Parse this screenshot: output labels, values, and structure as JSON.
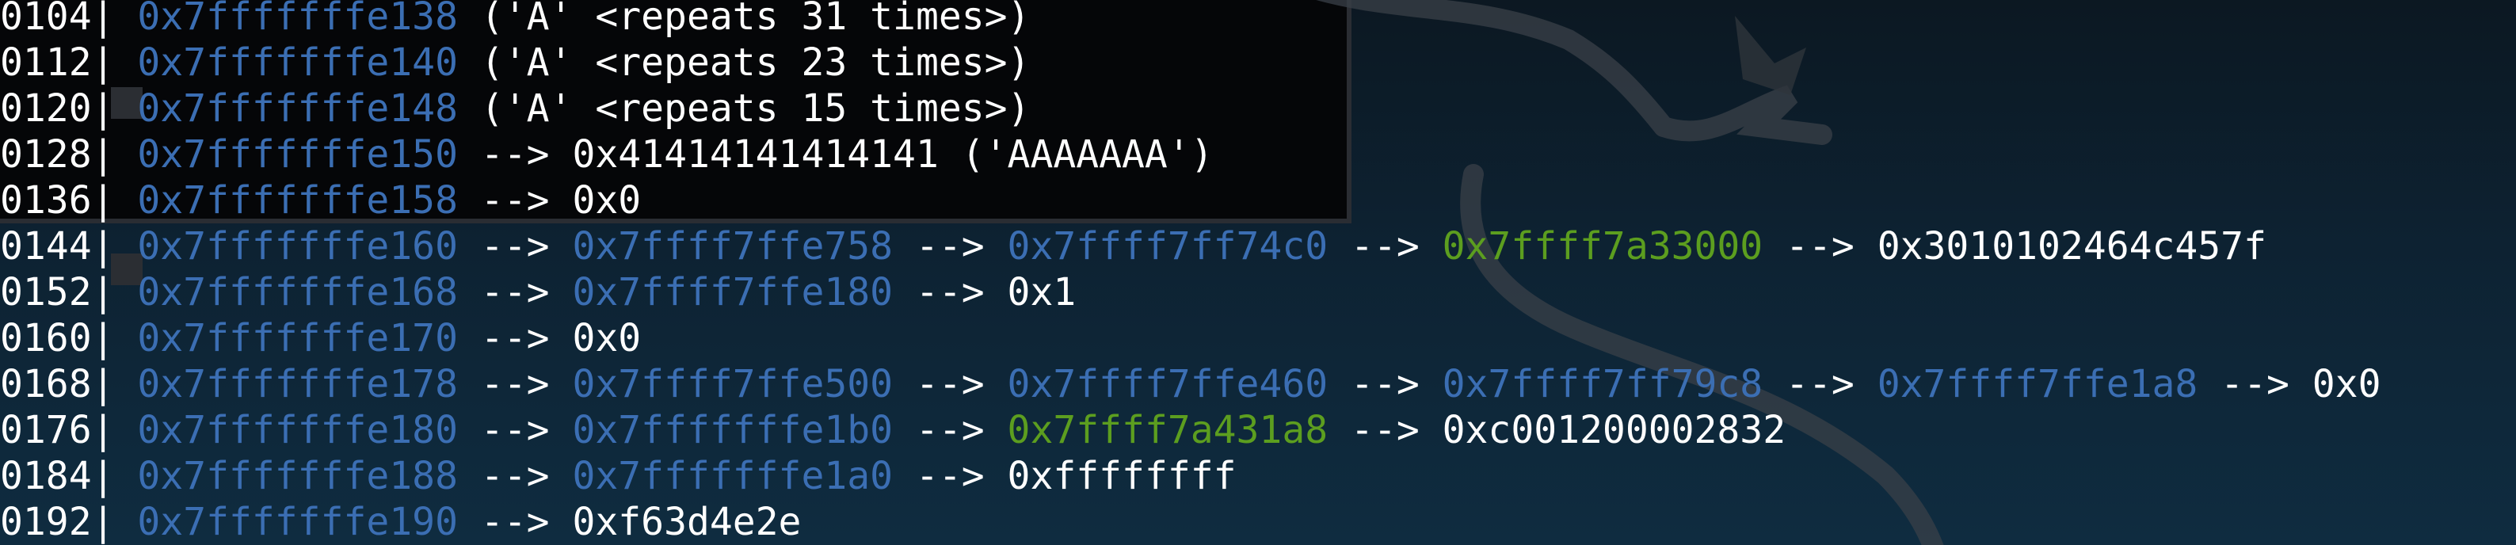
{
  "colors": {
    "stack_address": "#3b6eb3",
    "code_address": "#5c9e1f",
    "value": "#ffffff",
    "background": "#0d2232"
  },
  "lines": [
    {
      "segments": [
        {
          "t": "0104| ",
          "c": "offset"
        },
        {
          "t": "0x7fffffffe138",
          "c": "addr"
        },
        {
          "t": " ('A' <repeats 31 times>)",
          "c": "text"
        }
      ]
    },
    {
      "segments": [
        {
          "t": "0112| ",
          "c": "offset"
        },
        {
          "t": "0x7fffffffe140",
          "c": "addr"
        },
        {
          "t": " ('A' <repeats 23 times>)",
          "c": "text"
        }
      ]
    },
    {
      "segments": [
        {
          "t": "0120| ",
          "c": "offset"
        },
        {
          "t": "0x7fffffffe148",
          "c": "addr"
        },
        {
          "t": " ('A' <repeats 15 times>)",
          "c": "text"
        }
      ]
    },
    {
      "segments": [
        {
          "t": "0128| ",
          "c": "offset"
        },
        {
          "t": "0x7fffffffe150",
          "c": "addr"
        },
        {
          "t": " --> ",
          "c": "arrow"
        },
        {
          "t": "0x41414141414141 ('AAAAAAA')",
          "c": "value"
        }
      ]
    },
    {
      "segments": [
        {
          "t": "0136| ",
          "c": "offset"
        },
        {
          "t": "0x7fffffffe158",
          "c": "addr"
        },
        {
          "t": " --> ",
          "c": "arrow"
        },
        {
          "t": "0x0",
          "c": "value"
        }
      ]
    },
    {
      "segments": [
        {
          "t": "0144| ",
          "c": "offset"
        },
        {
          "t": "0x7fffffffe160",
          "c": "addr"
        },
        {
          "t": " --> ",
          "c": "arrow"
        },
        {
          "t": "0x7ffff7ffe758",
          "c": "addr"
        },
        {
          "t": " --> ",
          "c": "arrow"
        },
        {
          "t": "0x7ffff7ff74c0",
          "c": "addr"
        },
        {
          "t": " --> ",
          "c": "arrow"
        },
        {
          "t": "0x7ffff7a33000",
          "c": "code"
        },
        {
          "t": " --> ",
          "c": "arrow"
        },
        {
          "t": "0x3010102464c457f",
          "c": "value"
        }
      ]
    },
    {
      "segments": [
        {
          "t": "0152| ",
          "c": "offset"
        },
        {
          "t": "0x7fffffffe168",
          "c": "addr"
        },
        {
          "t": " --> ",
          "c": "arrow"
        },
        {
          "t": "0x7ffff7ffe180",
          "c": "addr"
        },
        {
          "t": " --> ",
          "c": "arrow"
        },
        {
          "t": "0x1",
          "c": "value"
        }
      ]
    },
    {
      "segments": [
        {
          "t": "0160| ",
          "c": "offset"
        },
        {
          "t": "0x7fffffffe170",
          "c": "addr"
        },
        {
          "t": " --> ",
          "c": "arrow"
        },
        {
          "t": "0x0",
          "c": "value"
        }
      ]
    },
    {
      "segments": [
        {
          "t": "0168| ",
          "c": "offset"
        },
        {
          "t": "0x7fffffffe178",
          "c": "addr"
        },
        {
          "t": " --> ",
          "c": "arrow"
        },
        {
          "t": "0x7ffff7ffe500",
          "c": "addr"
        },
        {
          "t": " --> ",
          "c": "arrow"
        },
        {
          "t": "0x7ffff7ffe460",
          "c": "addr"
        },
        {
          "t": " --> ",
          "c": "arrow"
        },
        {
          "t": "0x7ffff7ff79c8",
          "c": "addr"
        },
        {
          "t": " --> ",
          "c": "arrow"
        },
        {
          "t": "0x7ffff7ffe1a8",
          "c": "addr"
        },
        {
          "t": " --> ",
          "c": "arrow"
        },
        {
          "t": "0x0",
          "c": "value"
        }
      ]
    },
    {
      "segments": [
        {
          "t": "0176| ",
          "c": "offset"
        },
        {
          "t": "0x7fffffffe180",
          "c": "addr"
        },
        {
          "t": " --> ",
          "c": "arrow"
        },
        {
          "t": "0x7fffffffe1b0",
          "c": "addr"
        },
        {
          "t": " --> ",
          "c": "arrow"
        },
        {
          "t": "0x7ffff7a431a8",
          "c": "code"
        },
        {
          "t": " --> ",
          "c": "arrow"
        },
        {
          "t": "0xc001200002832",
          "c": "value"
        }
      ]
    },
    {
      "segments": [
        {
          "t": "0184| ",
          "c": "offset"
        },
        {
          "t": "0x7fffffffe188",
          "c": "addr"
        },
        {
          "t": " --> ",
          "c": "arrow"
        },
        {
          "t": "0x7fffffffe1a0",
          "c": "addr"
        },
        {
          "t": " --> ",
          "c": "arrow"
        },
        {
          "t": "0xffffffff",
          "c": "value"
        }
      ]
    },
    {
      "segments": [
        {
          "t": "0192| ",
          "c": "offset"
        },
        {
          "t": "0x7fffffffe190",
          "c": "addr"
        },
        {
          "t": " --> ",
          "c": "arrow"
        },
        {
          "t": "0xf63d4e2e",
          "c": "value"
        }
      ]
    }
  ]
}
